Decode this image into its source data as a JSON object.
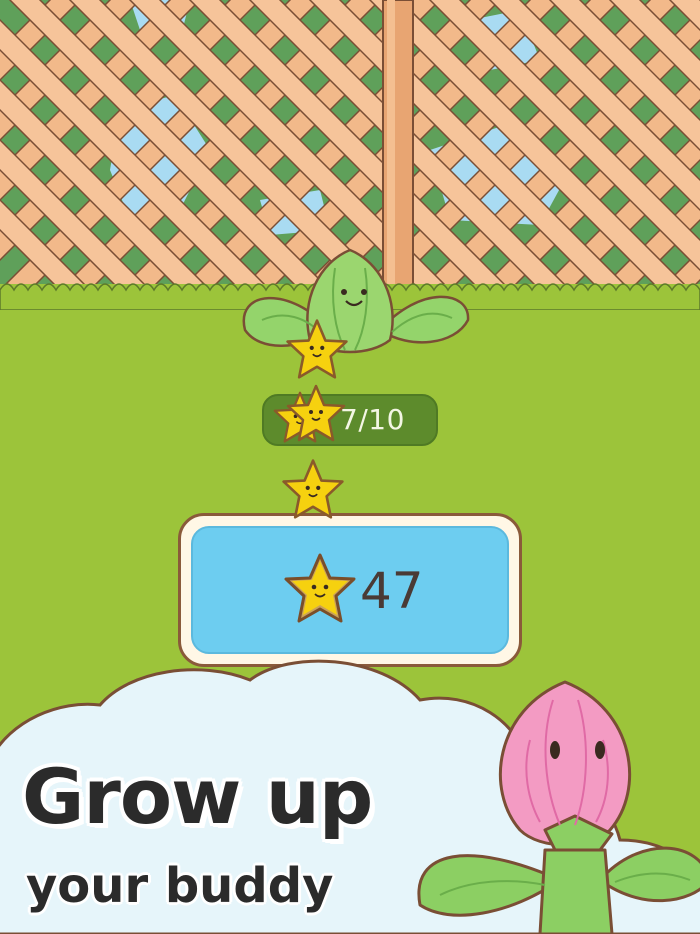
{
  "progress": {
    "current": 7,
    "max": 10,
    "label": "7/10"
  },
  "score": {
    "value": "47"
  },
  "promo": {
    "headline": "Grow up",
    "subline": "your buddy"
  },
  "colors": {
    "fence": "#f2b98a",
    "fence_shadow": "#d99a68",
    "lattice_bg": "#5fa05a",
    "sky": "#a9dbf2",
    "grass": "#9cc43a",
    "cloud": "#e6f5fa",
    "star": "#f6d10f",
    "score_panel": "#6dcdf0",
    "progress_pill": "#5d8b2c",
    "buddy_green": "#8ccf63",
    "buddy_pink": "#f39bc3"
  },
  "icons": [
    "star-icon",
    "green-buddy",
    "pink-bud-buddy"
  ]
}
